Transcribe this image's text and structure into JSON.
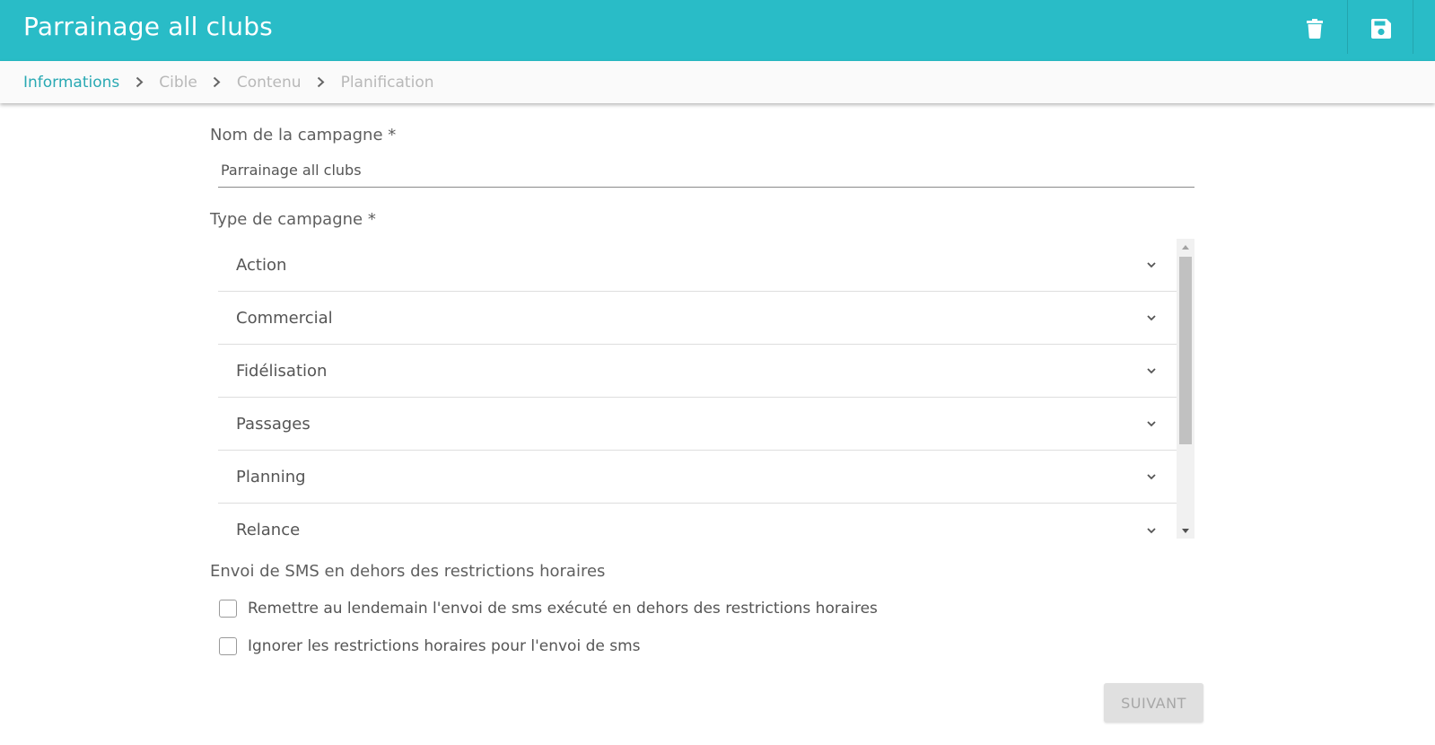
{
  "header": {
    "title": "Parrainage all clubs",
    "background": "#29bcc7",
    "actions": [
      {
        "name": "delete",
        "icon": "trash-icon"
      },
      {
        "name": "save",
        "icon": "floppy-disk-icon"
      }
    ]
  },
  "stepper": {
    "steps": [
      {
        "label": "Informations",
        "active": true
      },
      {
        "label": "Cible",
        "active": false
      },
      {
        "label": "Contenu",
        "active": false
      },
      {
        "label": "Planification",
        "active": false
      }
    ],
    "active_color": "#29a9b3"
  },
  "form": {
    "name_label": "Nom de la campagne *",
    "name_value": "Parrainage all clubs",
    "type_label": "Type de campagne *",
    "types": [
      "Action",
      "Commercial",
      "Fidélisation",
      "Passages",
      "Planning",
      "Relance"
    ],
    "sms_section_label": "Envoi de SMS en dehors des restrictions horaires",
    "options": [
      {
        "label": "Remettre au lendemain l'envoi de sms exécuté en dehors des restrictions horaires",
        "checked": false
      },
      {
        "label": "Ignorer les restrictions horaires pour l'envoi de sms",
        "checked": false
      }
    ],
    "next_label": "SUIVANT",
    "next_disabled": true
  }
}
